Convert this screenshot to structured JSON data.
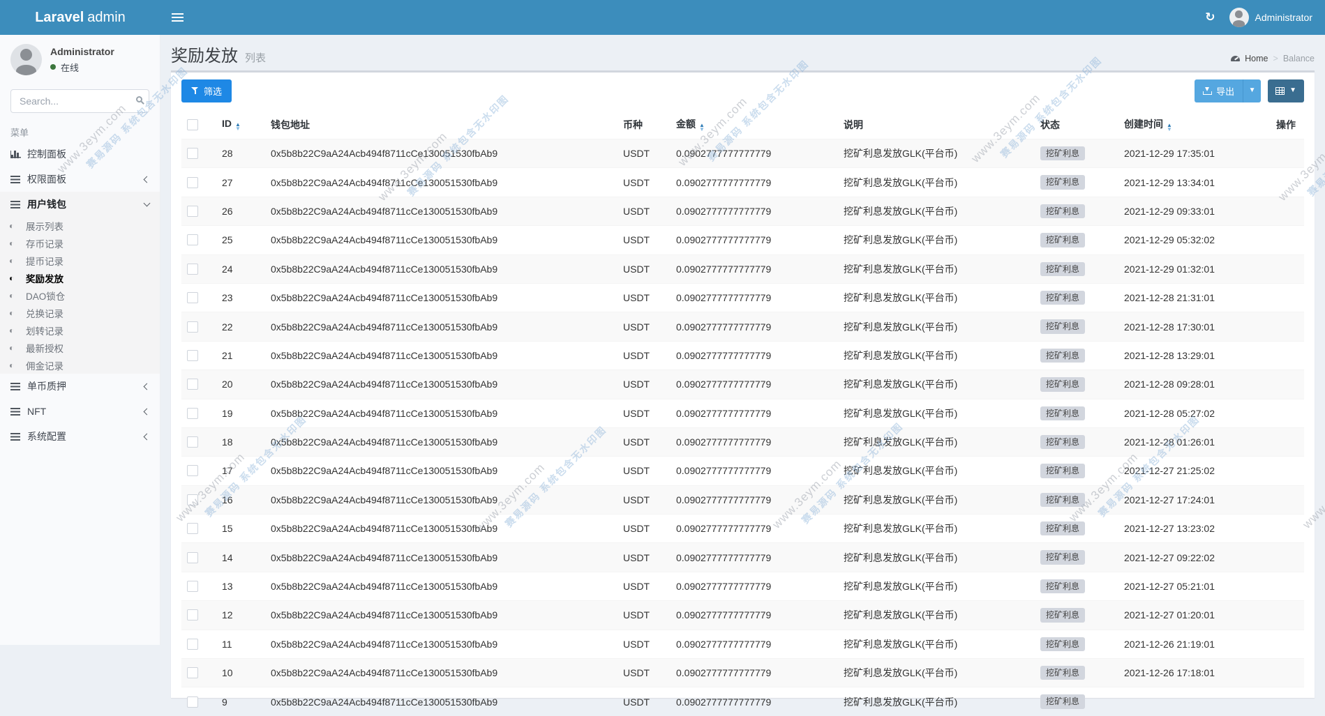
{
  "colors": {
    "navbar": "#3c8dbc",
    "filter_button": "#1e88e5",
    "export_button": "#55a7e0",
    "grid_button": "#3a6d90",
    "badge_bg": "#d2d6de",
    "online_dot": "#3c763d"
  },
  "navbar": {
    "brand_bold": "Laravel",
    "brand_rest": "admin",
    "user": "Administrator"
  },
  "sidebar": {
    "user": {
      "name": "Administrator",
      "status": "在线"
    },
    "search_placeholder": "Search...",
    "menu_label": "菜单",
    "menu": [
      {
        "label": "控制面板",
        "cls": "top ic-chart"
      },
      {
        "label": "权限面板",
        "cls": "top ic-bars chev-left"
      },
      {
        "label": "用户钱包",
        "cls": "top ic-bars chev-down open"
      },
      {
        "label": "展示列表",
        "cls": "sub"
      },
      {
        "label": "存币记录",
        "cls": "sub"
      },
      {
        "label": "提币记录",
        "cls": "sub"
      },
      {
        "label": "奖励发放",
        "cls": "sub active"
      },
      {
        "label": "DAO锁仓",
        "cls": "sub"
      },
      {
        "label": "兑换记录",
        "cls": "sub"
      },
      {
        "label": "划转记录",
        "cls": "sub"
      },
      {
        "label": "最新授权",
        "cls": "sub"
      },
      {
        "label": "佣金记录",
        "cls": "sub"
      },
      {
        "label": "单币质押",
        "cls": "top ic-bars chev-left"
      },
      {
        "label": "NFT",
        "cls": "top ic-bars chev-left"
      },
      {
        "label": "系统配置",
        "cls": "top ic-bars chev-left"
      }
    ]
  },
  "header": {
    "title": "奖励发放",
    "subtitle": "列表",
    "breadcrumb": {
      "home": "Home",
      "sep": ">",
      "current": "Balance"
    }
  },
  "toolbar": {
    "filter_label": "筛选",
    "export_label": "导出"
  },
  "table": {
    "columns": [
      {
        "label": "ID",
        "cls": "c-id sortable"
      },
      {
        "label": "钱包地址",
        "cls": "c-addr"
      },
      {
        "label": "币种",
        "cls": "c-coin"
      },
      {
        "label": "金额",
        "cls": "c-amount sortable"
      },
      {
        "label": "说明",
        "cls": "c-desc"
      },
      {
        "label": "状态",
        "cls": "c-status"
      },
      {
        "label": "创建时间",
        "cls": "c-created sortable"
      },
      {
        "label": "操作",
        "cls": "c-op"
      }
    ],
    "rows": [
      {
        "id": "28",
        "address": "0x5b8b22C9aA24Acb494f8711cCe130051530fbAb9",
        "coin": "USDT",
        "amount": "0.0902777777777779",
        "desc": "挖矿利息发放GLK(平台币)",
        "status": "挖矿利息",
        "created": "2021-12-29 17:35:01"
      },
      {
        "id": "27",
        "address": "0x5b8b22C9aA24Acb494f8711cCe130051530fbAb9",
        "coin": "USDT",
        "amount": "0.0902777777777779",
        "desc": "挖矿利息发放GLK(平台币)",
        "status": "挖矿利息",
        "created": "2021-12-29 13:34:01"
      },
      {
        "id": "26",
        "address": "0x5b8b22C9aA24Acb494f8711cCe130051530fbAb9",
        "coin": "USDT",
        "amount": "0.0902777777777779",
        "desc": "挖矿利息发放GLK(平台币)",
        "status": "挖矿利息",
        "created": "2021-12-29 09:33:01"
      },
      {
        "id": "25",
        "address": "0x5b8b22C9aA24Acb494f8711cCe130051530fbAb9",
        "coin": "USDT",
        "amount": "0.0902777777777779",
        "desc": "挖矿利息发放GLK(平台币)",
        "status": "挖矿利息",
        "created": "2021-12-29 05:32:02"
      },
      {
        "id": "24",
        "address": "0x5b8b22C9aA24Acb494f8711cCe130051530fbAb9",
        "coin": "USDT",
        "amount": "0.0902777777777779",
        "desc": "挖矿利息发放GLK(平台币)",
        "status": "挖矿利息",
        "created": "2021-12-29 01:32:01"
      },
      {
        "id": "23",
        "address": "0x5b8b22C9aA24Acb494f8711cCe130051530fbAb9",
        "coin": "USDT",
        "amount": "0.0902777777777779",
        "desc": "挖矿利息发放GLK(平台币)",
        "status": "挖矿利息",
        "created": "2021-12-28 21:31:01"
      },
      {
        "id": "22",
        "address": "0x5b8b22C9aA24Acb494f8711cCe130051530fbAb9",
        "coin": "USDT",
        "amount": "0.0902777777777779",
        "desc": "挖矿利息发放GLK(平台币)",
        "status": "挖矿利息",
        "created": "2021-12-28 17:30:01"
      },
      {
        "id": "21",
        "address": "0x5b8b22C9aA24Acb494f8711cCe130051530fbAb9",
        "coin": "USDT",
        "amount": "0.0902777777777779",
        "desc": "挖矿利息发放GLK(平台币)",
        "status": "挖矿利息",
        "created": "2021-12-28 13:29:01"
      },
      {
        "id": "20",
        "address": "0x5b8b22C9aA24Acb494f8711cCe130051530fbAb9",
        "coin": "USDT",
        "amount": "0.0902777777777779",
        "desc": "挖矿利息发放GLK(平台币)",
        "status": "挖矿利息",
        "created": "2021-12-28 09:28:01"
      },
      {
        "id": "19",
        "address": "0x5b8b22C9aA24Acb494f8711cCe130051530fbAb9",
        "coin": "USDT",
        "amount": "0.0902777777777779",
        "desc": "挖矿利息发放GLK(平台币)",
        "status": "挖矿利息",
        "created": "2021-12-28 05:27:02"
      },
      {
        "id": "18",
        "address": "0x5b8b22C9aA24Acb494f8711cCe130051530fbAb9",
        "coin": "USDT",
        "amount": "0.0902777777777779",
        "desc": "挖矿利息发放GLK(平台币)",
        "status": "挖矿利息",
        "created": "2021-12-28 01:26:01"
      },
      {
        "id": "17",
        "address": "0x5b8b22C9aA24Acb494f8711cCe130051530fbAb9",
        "coin": "USDT",
        "amount": "0.0902777777777779",
        "desc": "挖矿利息发放GLK(平台币)",
        "status": "挖矿利息",
        "created": "2021-12-27 21:25:02"
      },
      {
        "id": "16",
        "address": "0x5b8b22C9aA24Acb494f8711cCe130051530fbAb9",
        "coin": "USDT",
        "amount": "0.0902777777777779",
        "desc": "挖矿利息发放GLK(平台币)",
        "status": "挖矿利息",
        "created": "2021-12-27 17:24:01"
      },
      {
        "id": "15",
        "address": "0x5b8b22C9aA24Acb494f8711cCe130051530fbAb9",
        "coin": "USDT",
        "amount": "0.0902777777777779",
        "desc": "挖矿利息发放GLK(平台币)",
        "status": "挖矿利息",
        "created": "2021-12-27 13:23:02"
      },
      {
        "id": "14",
        "address": "0x5b8b22C9aA24Acb494f8711cCe130051530fbAb9",
        "coin": "USDT",
        "amount": "0.0902777777777779",
        "desc": "挖矿利息发放GLK(平台币)",
        "status": "挖矿利息",
        "created": "2021-12-27 09:22:02"
      },
      {
        "id": "13",
        "address": "0x5b8b22C9aA24Acb494f8711cCe130051530fbAb9",
        "coin": "USDT",
        "amount": "0.0902777777777779",
        "desc": "挖矿利息发放GLK(平台币)",
        "status": "挖矿利息",
        "created": "2021-12-27 05:21:01"
      },
      {
        "id": "12",
        "address": "0x5b8b22C9aA24Acb494f8711cCe130051530fbAb9",
        "coin": "USDT",
        "amount": "0.0902777777777779",
        "desc": "挖矿利息发放GLK(平台币)",
        "status": "挖矿利息",
        "created": "2021-12-27 01:20:01"
      },
      {
        "id": "11",
        "address": "0x5b8b22C9aA24Acb494f8711cCe130051530fbAb9",
        "coin": "USDT",
        "amount": "0.0902777777777779",
        "desc": "挖矿利息发放GLK(平台币)",
        "status": "挖矿利息",
        "created": "2021-12-26 21:19:01"
      },
      {
        "id": "10",
        "address": "0x5b8b22C9aA24Acb494f8711cCe130051530fbAb9",
        "coin": "USDT",
        "amount": "0.0902777777777779",
        "desc": "挖矿利息发放GLK(平台币)",
        "status": "挖矿利息",
        "created": "2021-12-26 17:18:01"
      },
      {
        "id": "9",
        "address": "0x5b8b22C9aA24Acb494f8711cCe130051530fbAb9",
        "coin": "USDT",
        "amount": "0.0902777777777779",
        "desc": "挖矿利息发放GLK(平台币)",
        "status": "挖矿利息",
        "created": ""
      }
    ]
  },
  "watermark": {
    "line1": "www.3eym.com",
    "line2": "赛易源码 系统包含无水印图"
  }
}
